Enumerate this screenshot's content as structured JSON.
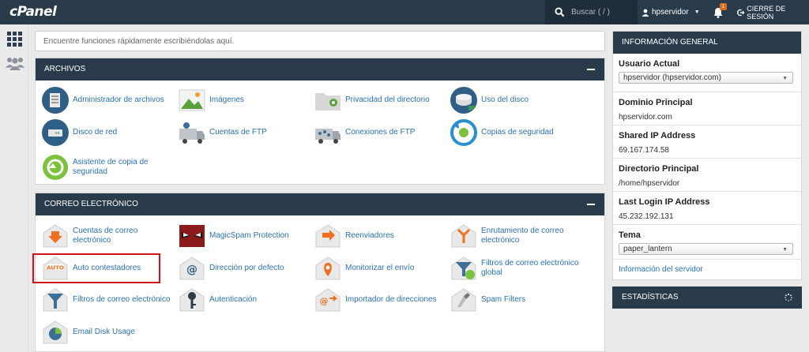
{
  "app": {
    "logo": "cPanel"
  },
  "topbar": {
    "search_placeholder": "Buscar ( / )",
    "username": "hpservidor",
    "notification_count": "1",
    "logout_label": "CIERRE DE SESIÓN"
  },
  "quick_search": {
    "placeholder": "Encuentre funciones rápidamente escribiéndolas aquí."
  },
  "files": {
    "title": "ARCHIVOS",
    "items": [
      {
        "label": "Administrador de archivos",
        "icon": "file-manager-icon"
      },
      {
        "label": "Imágenes",
        "icon": "images-icon"
      },
      {
        "label": "Privacidad del directorio",
        "icon": "directory-privacy-icon"
      },
      {
        "label": "Uso del disco",
        "icon": "disk-usage-icon"
      },
      {
        "label": "Disco de red",
        "icon": "web-disk-icon"
      },
      {
        "label": "Cuentas de FTP",
        "icon": "ftp-accounts-icon"
      },
      {
        "label": "Conexiones de FTP",
        "icon": "ftp-connections-icon"
      },
      {
        "label": "Copias de seguridad",
        "icon": "backup-icon"
      },
      {
        "label": "Asistente de copia de seguridad",
        "icon": "backup-wizard-icon"
      }
    ]
  },
  "email": {
    "title": "CORREO ELECTRÓNICO",
    "items": [
      {
        "label": "Cuentas de correo electrónico",
        "icon": "email-accounts-icon"
      },
      {
        "label": "MagicSpam Protection",
        "icon": "magicspam-icon"
      },
      {
        "label": "Reenviadores",
        "icon": "forwarders-icon"
      },
      {
        "label": "Enrutamiento de correo electrónico",
        "icon": "email-routing-icon"
      },
      {
        "label": "Auto contestadores",
        "icon": "autoresponders-icon"
      },
      {
        "label": "Dirección por defecto",
        "icon": "default-address-icon"
      },
      {
        "label": "Monitorizar el envío",
        "icon": "track-delivery-icon"
      },
      {
        "label": "Filtros de correo electrónico global",
        "icon": "global-email-filters-icon"
      },
      {
        "label": "Filtros de correo electrónico",
        "icon": "email-filters-icon"
      },
      {
        "label": "Autenticación",
        "icon": "authentication-icon"
      },
      {
        "label": "Importador de direcciones",
        "icon": "address-importer-icon"
      },
      {
        "label": "Spam Filters",
        "icon": "spam-filters-icon"
      },
      {
        "label": "Email Disk Usage",
        "icon": "email-disk-usage-icon"
      }
    ]
  },
  "general_info": {
    "title": "INFORMACIÓN GENERAL",
    "current_user_label": "Usuario Actual",
    "current_user_value": "hpservidor (hpservidor.com)",
    "main_domain_label": "Dominio Principal",
    "main_domain_value": "hpservidor.com",
    "shared_ip_label": "Shared IP Address",
    "shared_ip_value": "69.167.174.58",
    "home_dir_label": "Directorio Principal",
    "home_dir_value": "/home/hpservidor",
    "last_login_label": "Last Login IP Address",
    "last_login_value": "45.232.192.131",
    "theme_label": "Tema",
    "theme_value": "paper_lantern",
    "server_info_link": "Información del servidor"
  },
  "stats": {
    "title": "ESTADÍSTICAS"
  },
  "colors": {
    "header_bg": "#293a4a",
    "link": "#2a72b5",
    "highlight": "#d0141c",
    "badge": "#e46a1d"
  }
}
